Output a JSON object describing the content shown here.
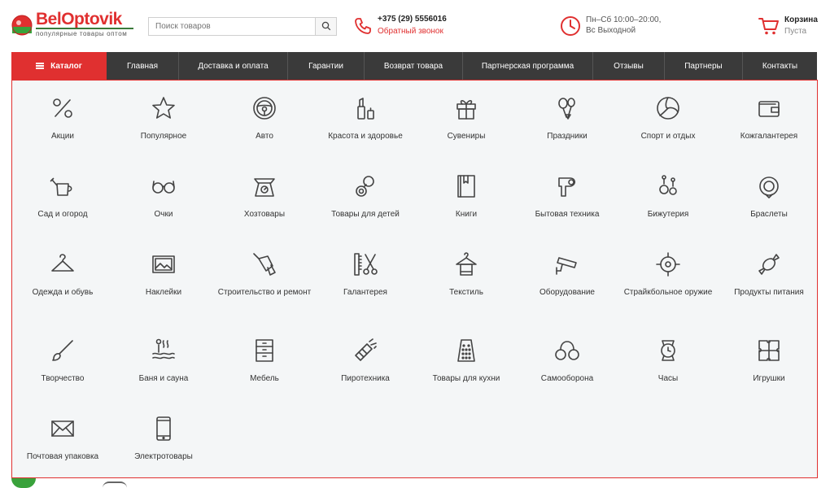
{
  "logo": {
    "part1": "Bel",
    "part2": "Optovik",
    "tagline": "популярные товары оптом",
    "brand_color": "#e03030",
    "accent_color": "#3a7a3a"
  },
  "search": {
    "placeholder": "Поиск товаров",
    "icon": "search-icon"
  },
  "phone": {
    "number": "+375 (29) 5556016",
    "callback": "Обратный звонок",
    "icon": "phone-icon"
  },
  "hours": {
    "line1": "Пн–Сб 10:00–20:00,",
    "line2": "Вс Выходной",
    "icon": "clock-icon"
  },
  "cart": {
    "title": "Корзина",
    "status": "Пуста",
    "icon": "cart-icon"
  },
  "nav": {
    "catalog": "Каталог",
    "items": [
      "Главная",
      "Доставка и оплата",
      "Гарантии",
      "Возврат товара",
      "Партнерская программа",
      "Отзывы",
      "Партнеры",
      "Контакты"
    ]
  },
  "categories": [
    {
      "label": "Акции",
      "icon": "percent-icon"
    },
    {
      "label": "Популярное",
      "icon": "star-icon"
    },
    {
      "label": "Авто",
      "icon": "steering-wheel-icon"
    },
    {
      "label": "Красота и здоровье",
      "icon": "cosmetics-icon"
    },
    {
      "label": "Сувениры",
      "icon": "gift-icon"
    },
    {
      "label": "Праздники",
      "icon": "balloons-icon"
    },
    {
      "label": "Спорт и отдых",
      "icon": "volleyball-icon"
    },
    {
      "label": "Кожгалантерея",
      "icon": "wallet-icon"
    },
    {
      "label": "Сад и огород",
      "icon": "watering-can-icon"
    },
    {
      "label": "Очки",
      "icon": "glasses-icon"
    },
    {
      "label": "Хозтовары",
      "icon": "scale-icon"
    },
    {
      "label": "Товары для детей",
      "icon": "pacifier-icon"
    },
    {
      "label": "Книги",
      "icon": "book-icon"
    },
    {
      "label": "Бытовая техника",
      "icon": "hairdryer-icon"
    },
    {
      "label": "Бижутерия",
      "icon": "earrings-icon"
    },
    {
      "label": "Браслеты",
      "icon": "bracelet-icon"
    },
    {
      "label": "Одежда и обувь",
      "icon": "hanger-icon"
    },
    {
      "label": "Наклейки",
      "icon": "picture-icon"
    },
    {
      "label": "Строительство и ремонт",
      "icon": "drill-icon"
    },
    {
      "label": "Галантерея",
      "icon": "comb-scissors-icon"
    },
    {
      "label": "Текстиль",
      "icon": "towel-hanger-icon"
    },
    {
      "label": "Оборудование",
      "icon": "security-camera-icon"
    },
    {
      "label": "Страйкбольное оружие",
      "icon": "crosshair-icon"
    },
    {
      "label": "Продукты питания",
      "icon": "candy-icon"
    },
    {
      "label": "Творчество",
      "icon": "brush-icon"
    },
    {
      "label": "Баня и сауна",
      "icon": "sauna-icon"
    },
    {
      "label": "Мебель",
      "icon": "drawers-icon"
    },
    {
      "label": "Пиротехника",
      "icon": "firework-icon"
    },
    {
      "label": "Товары для кухни",
      "icon": "grater-icon"
    },
    {
      "label": "Самооборона",
      "icon": "handcuffs-icon"
    },
    {
      "label": "Часы",
      "icon": "watch-icon"
    },
    {
      "label": "Игрушки",
      "icon": "puzzle-icon"
    },
    {
      "label": "Почтовая упаковка",
      "icon": "envelope-icon"
    },
    {
      "label": "Электротовары",
      "icon": "smartphone-icon"
    }
  ]
}
